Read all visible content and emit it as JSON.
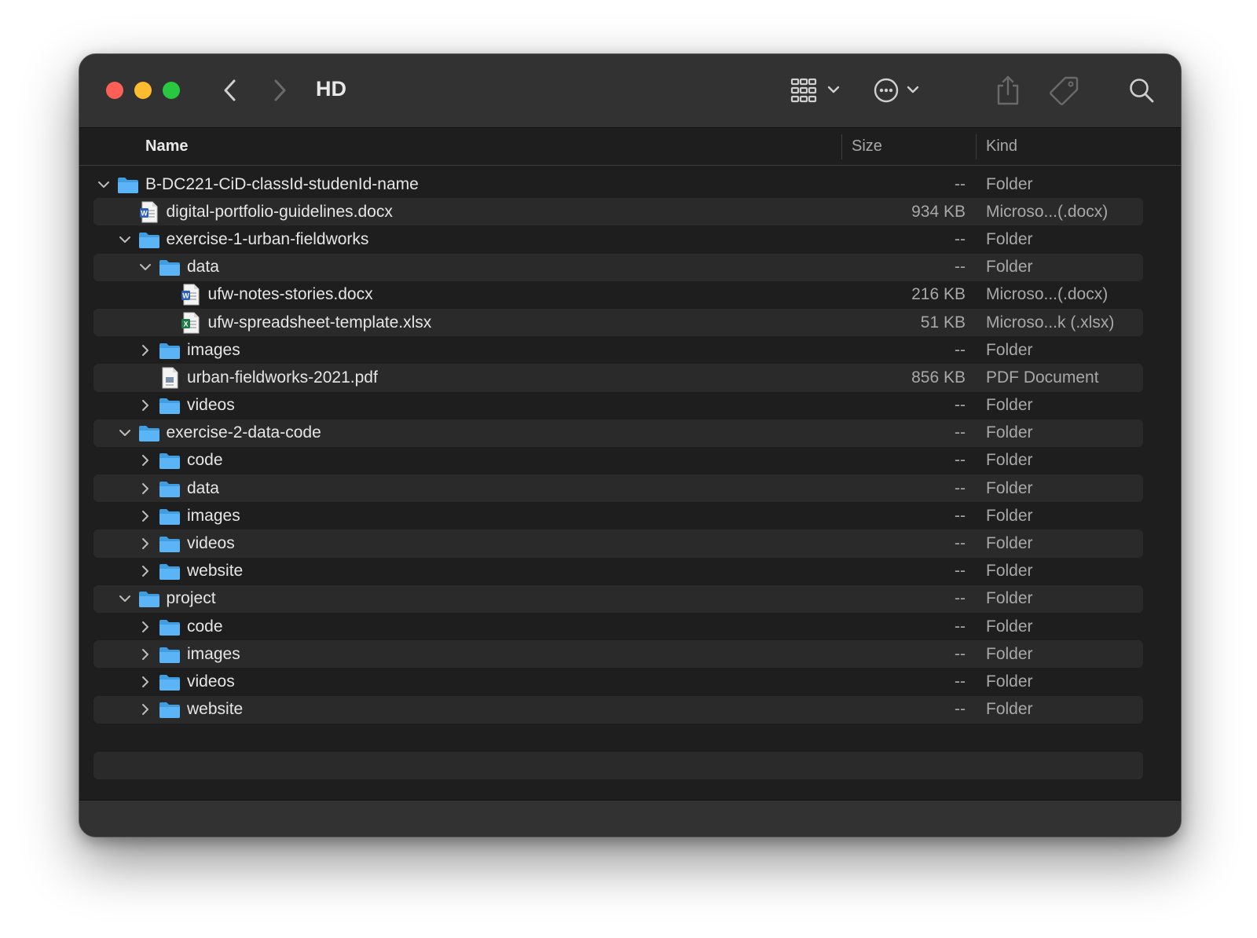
{
  "window": {
    "title": "HD"
  },
  "toolbar": {
    "back_icon": "chevron-left-icon",
    "forward_icon": "chevron-right-icon",
    "view_icon": "grid-view-icon",
    "action_icon": "ellipsis-circle-icon",
    "share_icon": "share-icon",
    "tag_icon": "tag-icon",
    "search_icon": "search-icon"
  },
  "columns": {
    "name": "Name",
    "size": "Size",
    "kind": "Kind"
  },
  "colors": {
    "folder": "#5ab4f5",
    "close": "#ff5f57",
    "minimize": "#febc2e",
    "maximize": "#28c840"
  },
  "rows": [
    {
      "depth": 0,
      "expander": "expanded",
      "icon": "folder-icon",
      "name": "B-DC221-CiD-classId-studenId-name",
      "size": "--",
      "kind": "Folder"
    },
    {
      "depth": 1,
      "expander": "none",
      "icon": "word-doc-icon",
      "name": "digital-portfolio-guidelines.docx",
      "size": "934 KB",
      "kind": "Microso...(.docx)"
    },
    {
      "depth": 1,
      "expander": "expanded",
      "icon": "folder-icon",
      "name": "exercise-1-urban-fieldworks",
      "size": "--",
      "kind": "Folder"
    },
    {
      "depth": 2,
      "expander": "expanded",
      "icon": "folder-icon",
      "name": "data",
      "size": "--",
      "kind": "Folder"
    },
    {
      "depth": 3,
      "expander": "none",
      "icon": "word-doc-icon",
      "name": "ufw-notes-stories.docx",
      "size": "216 KB",
      "kind": "Microso...(.docx)"
    },
    {
      "depth": 3,
      "expander": "none",
      "icon": "excel-sheet-icon",
      "name": "ufw-spreadsheet-template.xlsx",
      "size": "51 KB",
      "kind": "Microso...k (.xlsx)"
    },
    {
      "depth": 2,
      "expander": "collapsed",
      "icon": "folder-icon",
      "name": "images",
      "size": "--",
      "kind": "Folder"
    },
    {
      "depth": 2,
      "expander": "none",
      "icon": "pdf-doc-icon",
      "name": "urban-fieldworks-2021.pdf",
      "size": "856 KB",
      "kind": "PDF Document"
    },
    {
      "depth": 2,
      "expander": "collapsed",
      "icon": "folder-icon",
      "name": "videos",
      "size": "--",
      "kind": "Folder"
    },
    {
      "depth": 1,
      "expander": "expanded",
      "icon": "folder-icon",
      "name": "exercise-2-data-code",
      "size": "--",
      "kind": "Folder"
    },
    {
      "depth": 2,
      "expander": "collapsed",
      "icon": "folder-icon",
      "name": "code",
      "size": "--",
      "kind": "Folder"
    },
    {
      "depth": 2,
      "expander": "collapsed",
      "icon": "folder-icon",
      "name": "data",
      "size": "--",
      "kind": "Folder"
    },
    {
      "depth": 2,
      "expander": "collapsed",
      "icon": "folder-icon",
      "name": "images",
      "size": "--",
      "kind": "Folder"
    },
    {
      "depth": 2,
      "expander": "collapsed",
      "icon": "folder-icon",
      "name": "videos",
      "size": "--",
      "kind": "Folder"
    },
    {
      "depth": 2,
      "expander": "collapsed",
      "icon": "folder-icon",
      "name": "website",
      "size": "--",
      "kind": "Folder"
    },
    {
      "depth": 1,
      "expander": "expanded",
      "icon": "folder-icon",
      "name": "project",
      "size": "--",
      "kind": "Folder"
    },
    {
      "depth": 2,
      "expander": "collapsed",
      "icon": "folder-icon",
      "name": "code",
      "size": "--",
      "kind": "Folder"
    },
    {
      "depth": 2,
      "expander": "collapsed",
      "icon": "folder-icon",
      "name": "images",
      "size": "--",
      "kind": "Folder"
    },
    {
      "depth": 2,
      "expander": "collapsed",
      "icon": "folder-icon",
      "name": "videos",
      "size": "--",
      "kind": "Folder"
    },
    {
      "depth": 2,
      "expander": "collapsed",
      "icon": "folder-icon",
      "name": "website",
      "size": "--",
      "kind": "Folder"
    }
  ]
}
